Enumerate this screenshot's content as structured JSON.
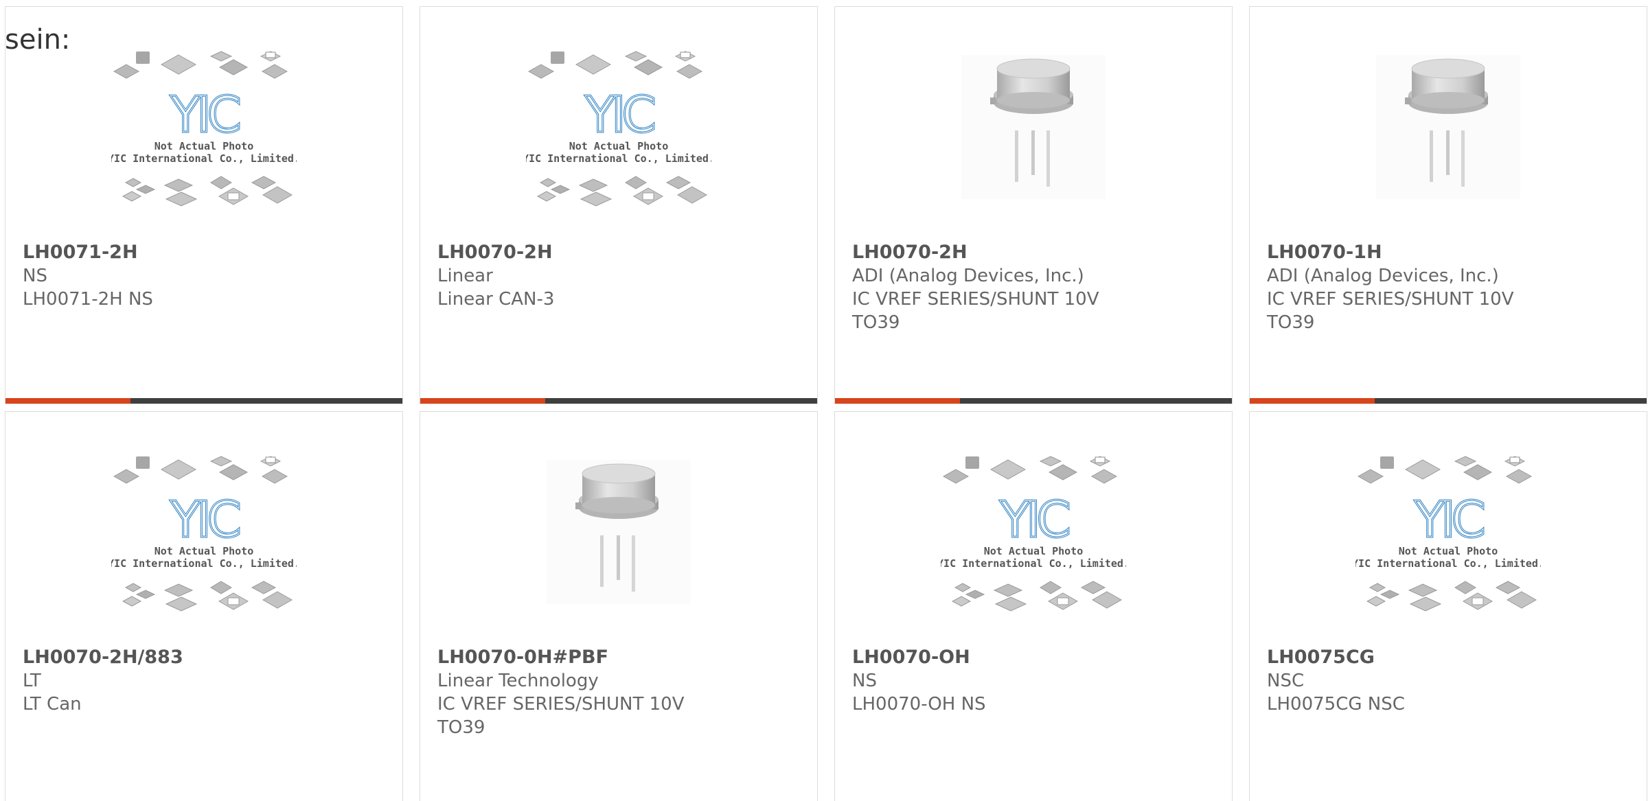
{
  "intro_text": "sein:",
  "placeholder": {
    "line1": "Not Actual Photo",
    "line2": "YIC International Co., Limited.",
    "logo": "YIC"
  },
  "colors": {
    "accent": "#d9441a",
    "bar": "#3f3f3f",
    "logo_blue": "#2a7fc1",
    "text": "#666666"
  },
  "products": [
    {
      "part": "LH0071-2H",
      "lines": [
        "NS",
        "LH0071-2H NS"
      ],
      "image": "placeholder"
    },
    {
      "part": "LH0070-2H",
      "lines": [
        "Linear",
        "Linear CAN-3"
      ],
      "image": "placeholder"
    },
    {
      "part": "LH0070-2H",
      "lines": [
        "ADI (Analog Devices, Inc.)",
        "IC VREF SERIES/SHUNT 10V",
        "TO39"
      ],
      "image": "to39"
    },
    {
      "part": "LH0070-1H",
      "lines": [
        "ADI (Analog Devices, Inc.)",
        "IC VREF SERIES/SHUNT 10V",
        "TO39"
      ],
      "image": "to39"
    },
    {
      "part": "LH0070-2H/883",
      "lines": [
        "LT",
        "LT Can"
      ],
      "image": "placeholder"
    },
    {
      "part": "LH0070-0H#PBF",
      "lines": [
        "Linear Technology",
        "IC VREF SERIES/SHUNT 10V",
        "TO39"
      ],
      "image": "to39"
    },
    {
      "part": "LH0070-OH",
      "lines": [
        "NS",
        "LH0070-OH NS"
      ],
      "image": "placeholder"
    },
    {
      "part": "LH0075CG",
      "lines": [
        "NSC",
        "LH0075CG NSC"
      ],
      "image": "placeholder"
    }
  ]
}
